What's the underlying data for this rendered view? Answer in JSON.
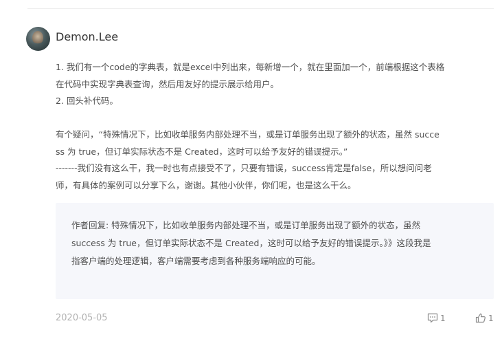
{
  "comment": {
    "author": "Demon.Lee",
    "lines": [
      "1. 我们有一个code的字典表，就是excel中列出来，每新增一个，就在里面加一个，前端根据这个表格",
      "在代码中实现字典表查询，然后用友好的提示展示给用户。",
      "2. 回头补代码。",
      "",
      "有个疑问，“特殊情况下，比如收单服务内部处理不当，或是订单服务出现了额外的状态，虽然 succe",
      "ss 为 true，但订单实际状态不是 Created，这时可以给予友好的错误提示。”",
      "-------我们没有这么干，我一时也有点接受不了，只要有错误，success肯定是false，所以想问问老",
      "师，有具体的案例可以分享下么，谢谢。其他小伙伴，你们呢，也是这么干么。"
    ],
    "reply_lines": [
      "作者回复: 特殊情况下，比如收单服务内部处理不当，或是订单服务出现了额外的状态，虽然",
      "success 为 true，但订单实际状态不是 Created，这时可以给予友好的错误提示。》》这段我是",
      "指客户端的处理逻辑，客户端需要考虑到各种服务端响应的可能。"
    ],
    "date": "2020-05-05",
    "reply_count": "1",
    "like_count": "1"
  },
  "icons": {
    "reply": "comment-icon",
    "like": "thumbs-up-icon"
  }
}
